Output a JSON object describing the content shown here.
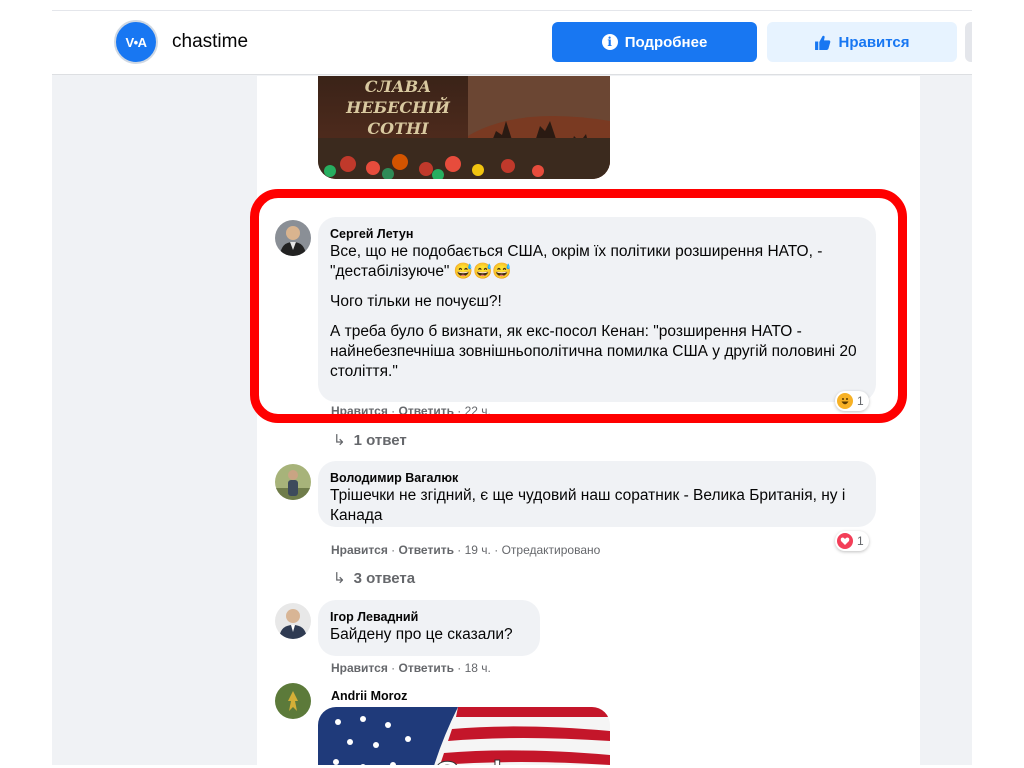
{
  "header": {
    "page_name": "chastime",
    "logo_text": "V•A",
    "more_button": "Подробнее",
    "like_button": "Нравится"
  },
  "images": {
    "top_caption_line1": "СЛАВА",
    "top_caption_line2": "НЕБЕСНІЙ",
    "top_caption_line3": "СОТНІ",
    "bottom_caption": "God"
  },
  "comments": [
    {
      "author": "Сергей Летун",
      "paragraphs": [
        "Все, що не подобається США, окрім їх політики розширення НАТО, - \"дестабілізуюче\" 😅😅😅",
        "Чого тільки не почуєш?!",
        "А треба було б визнати, як екс-посол Кенан: \"розширення НАТО - найнебезпечніша зовнішньополітична помилка США у другій половині 20 століття.\""
      ],
      "like": "Нравится",
      "reply": "Ответить",
      "time": "22 ч.",
      "reaction_count": "1",
      "replies": "1 ответ"
    },
    {
      "author": "Володимир Вагалюк",
      "paragraphs": [
        "Трішечки не згідний, є ще чудовий наш соратник - Велика Британія, ну і Канада"
      ],
      "like": "Нравится",
      "reply": "Ответить",
      "time": "19 ч.",
      "edited": "Отредактировано",
      "reaction_count": "1",
      "replies": "3 ответа"
    },
    {
      "author": "Ігор Левадний",
      "paragraphs": [
        "Байдену про це сказали?"
      ],
      "like": "Нравится",
      "reply": "Ответить",
      "time": "18 ч."
    },
    {
      "author": "Andrii Moroz"
    }
  ],
  "colors": {
    "accent": "#1877f2",
    "highlight": "#ff0000",
    "bubble": "#f0f2f5",
    "meta": "#65676b"
  }
}
